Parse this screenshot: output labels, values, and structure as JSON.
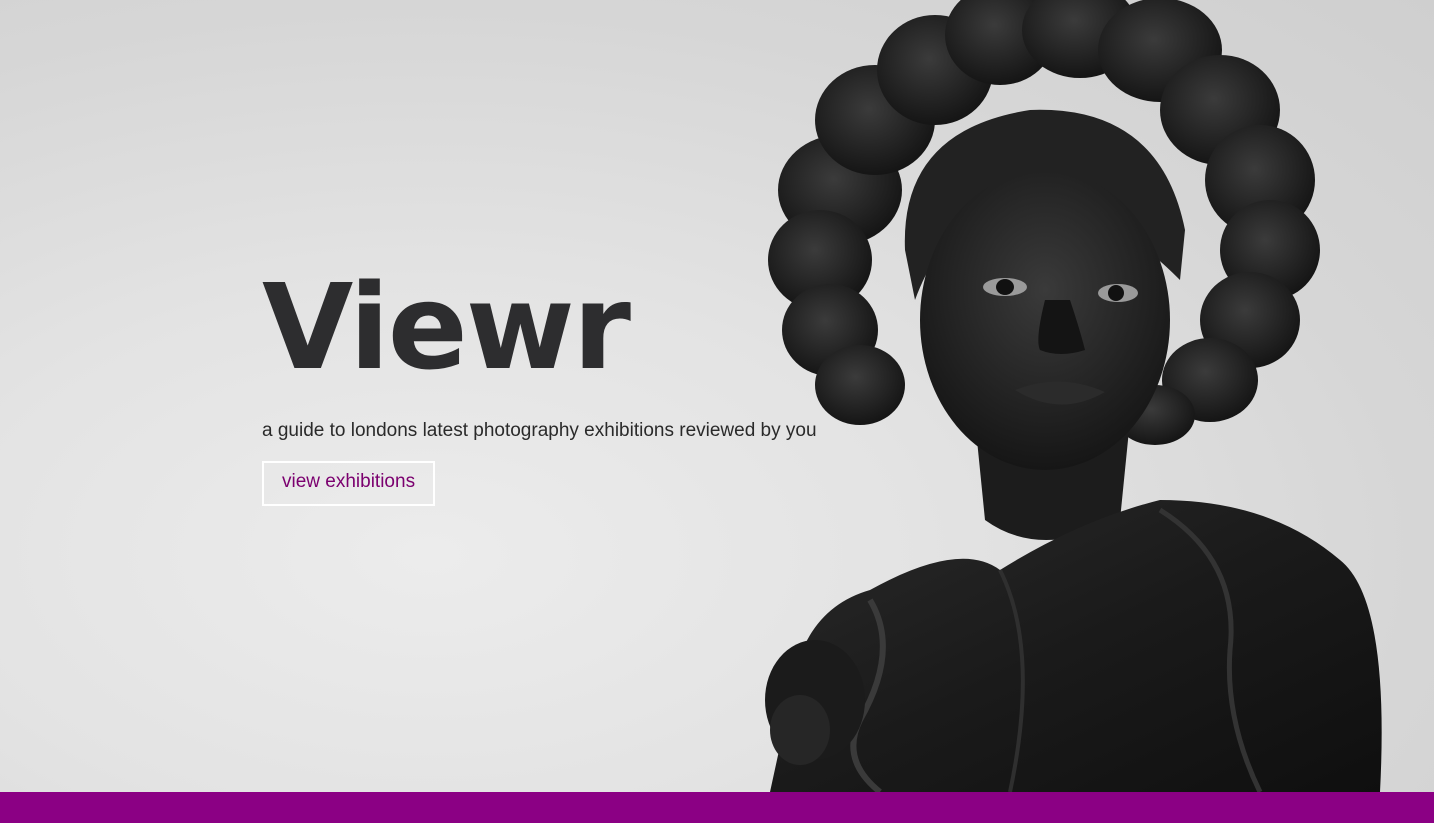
{
  "hero": {
    "title": "Viewr",
    "tagline": "a guide to londons latest photography exhibitions reviewed by you",
    "cta_label": "view exhibitions"
  },
  "colors": {
    "accent": "#8b0084",
    "cta_text": "#7b006f",
    "title_text": "#2d2d2f"
  }
}
